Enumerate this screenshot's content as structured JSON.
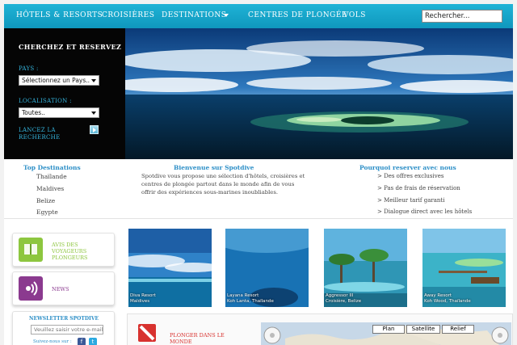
{
  "nav": {
    "hotels": "HÔTELS & RESORTS",
    "cruises": "CROISIÈRES",
    "destinations": "DESTINATIONS",
    "centres": "CENTRES DE PLONGÉE",
    "flights": "VOLS",
    "search_value": "Rechercher..."
  },
  "search_panel": {
    "heading": "CHERCHEZ ET RESERVEZ",
    "country_label": "PAYS :",
    "country_value": "Sélectionnez un Pays..",
    "location_label": "LOCALISATION :",
    "location_value": "Toutes..",
    "launch_label": "LANCEZ LA RECHERCHE"
  },
  "top_destinations": {
    "heading": "Top Destinations",
    "items": [
      "Thaïlande",
      "Maldives",
      "Belize",
      "Egypte"
    ]
  },
  "welcome": {
    "heading": "Bienvenue sur Spotdive",
    "text": "Spotdive vous propose une sélection d'hôtels, croisières et centres de plongée partout dans le monde afin de vous offrir des expériences sous-marines inoubliables."
  },
  "reasons": {
    "heading": "Pourquoi reserver avec nous",
    "items": [
      "> Des offres exclusives",
      "> Pas de frais de réservation",
      "> Meilleur tarif garanti",
      "> Dialogue direct avec les hôtels"
    ]
  },
  "widgets": {
    "travelers_label_1": "AVIS DES",
    "travelers_label_2": "VOYAGEURS",
    "travelers_label_3": "PLONGEURS",
    "news_label": "NEWS"
  },
  "newsletter": {
    "title": "NEWSLETTER SPOTDIVE",
    "placeholder": "Veuillez saisir votre e-mail",
    "follow": "Suivez-nous sur :",
    "facebook_glyph": "f",
    "twitter_glyph": "t"
  },
  "resorts": [
    {
      "name": "Diva Resort",
      "location": "Maldives"
    },
    {
      "name": "Layana Resort",
      "location": "Koh Lanta, Thaïlande"
    },
    {
      "name": "Aggressor III",
      "location": "Croisière, Belize"
    },
    {
      "name": "Away Resort",
      "location": "Koh Wood, Thaïlande"
    }
  ],
  "bottom": {
    "dive_title": "PLONGER DANS LE MONDE",
    "map_plan": "Plan",
    "map_satellite": "Satellite",
    "map_relief": "Relief"
  },
  "colors": {
    "nav_bg": "#1fb3d6",
    "accent_blue": "#2d8fc7",
    "panel_label": "#36b7e0",
    "dive_red": "#d8322f",
    "widget_green": "#8dc63f",
    "widget_purple": "#8b3a8f"
  }
}
